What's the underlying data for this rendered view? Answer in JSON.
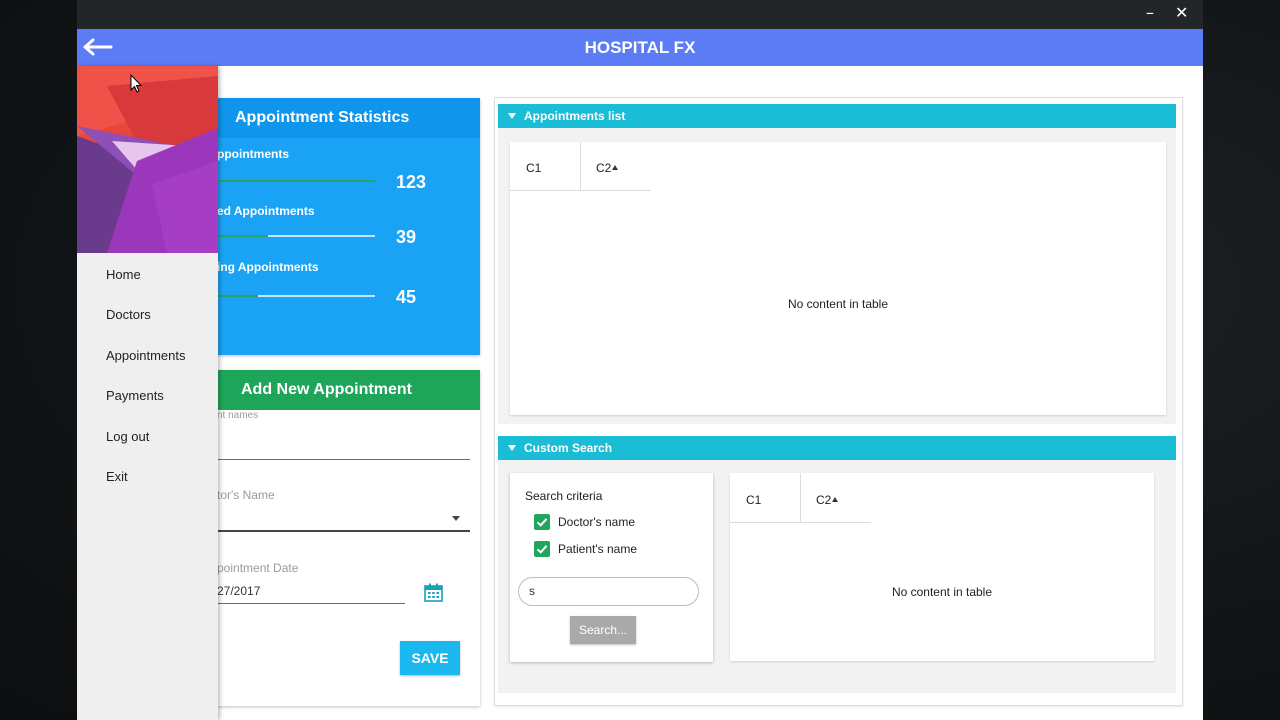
{
  "window": {
    "title": "HOSPITAL FX",
    "minimize_glyph": "–",
    "close_glyph": "✕",
    "back_icon": "arrow-left-icon"
  },
  "colors": {
    "appbar": "#5b7cf5",
    "stats_card": "#1aa3f5",
    "add_header": "#1fa55a",
    "titled_pane_header": "#1abcd6",
    "save_button": "#1ab8ef"
  },
  "drawer": {
    "items": [
      {
        "label": "Home"
      },
      {
        "label": "Doctors"
      },
      {
        "label": "Appointments"
      },
      {
        "label": "Payments"
      },
      {
        "label": "Log out"
      },
      {
        "label": "Exit"
      }
    ]
  },
  "stats": {
    "title": "Appointment Statistics",
    "rows": [
      {
        "label": "ppointments",
        "value": "123",
        "progress": 1.0
      },
      {
        "label": "ed Appointments",
        "value": "39",
        "progress": 0.32
      },
      {
        "label": "ing Appointments",
        "value": "45",
        "progress": 0.26
      }
    ]
  },
  "add_appointment": {
    "title": "Add New Appointment",
    "patient_label": "nt names",
    "doctor_label": "tor's Name",
    "date_label": "pointment Date",
    "date_value": "27/2017",
    "save_label": "SAVE"
  },
  "appointments_list": {
    "title": "Appointments list",
    "columns": [
      "C1",
      "C2"
    ],
    "empty_message": "No content in table"
  },
  "custom_search": {
    "title": "Custom Search",
    "criteria_title": "Search criteria",
    "checkboxes": [
      {
        "label": "Doctor's name",
        "checked": true
      },
      {
        "label": "Patient's name",
        "checked": true
      }
    ],
    "search_value": "s",
    "search_button": "Search...",
    "columns": [
      "C1",
      "C2"
    ],
    "empty_message": "No content in table"
  }
}
